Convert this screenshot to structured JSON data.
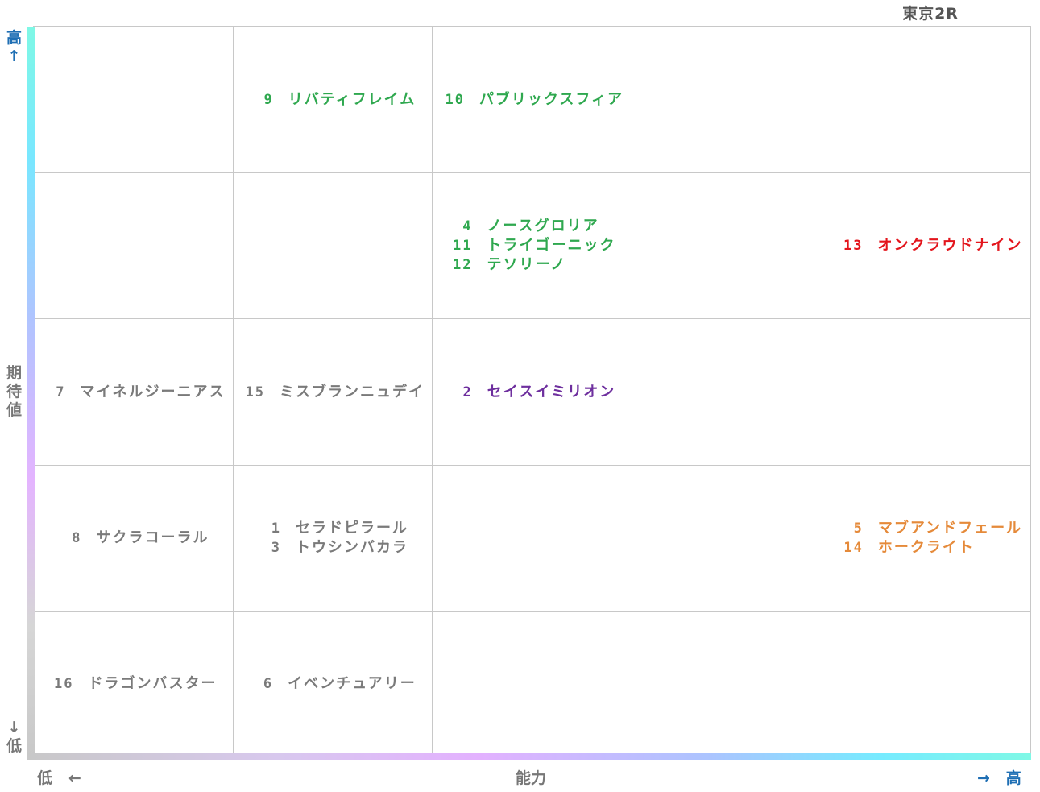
{
  "title": "東京2R",
  "axes": {
    "y_high": "高",
    "y_high_arrow": "↑",
    "y_label": [
      "期",
      "待",
      "値"
    ],
    "y_low_arrow": "↓",
    "y_low": "低",
    "x_low": "低",
    "x_low_arrow": "←",
    "x_label": "能力",
    "x_high_arrow": "→",
    "x_high": "高"
  },
  "colors": {
    "green": "#2fa84f",
    "red": "#e3151c",
    "purple": "#6e2f9e",
    "gray": "#7a7a7a",
    "orange": "#e58a3a",
    "axis_text": "#777777",
    "axis_accent": "#1f6fb4",
    "grid": "#c8c8c8"
  },
  "chart_data": {
    "type": "table",
    "title": "東京2R",
    "xlabel": "能力",
    "ylabel": "期待値",
    "columns": 5,
    "rows": 5,
    "cells": [
      {
        "row": 0,
        "col": 1,
        "color": "green",
        "entries": [
          {
            "num": "9",
            "name": "リバティフレイム"
          }
        ]
      },
      {
        "row": 0,
        "col": 2,
        "color": "green",
        "entries": [
          {
            "num": "10",
            "name": "パブリックスフィア"
          }
        ]
      },
      {
        "row": 1,
        "col": 2,
        "color": "green",
        "entries": [
          {
            "num": "4",
            "name": "ノースグロリア"
          },
          {
            "num": "11",
            "name": "トライゴーニック"
          },
          {
            "num": "12",
            "name": "テソリーノ"
          }
        ]
      },
      {
        "row": 1,
        "col": 4,
        "color": "red",
        "entries": [
          {
            "num": "13",
            "name": "オンクラウドナイン"
          }
        ]
      },
      {
        "row": 2,
        "col": 0,
        "color": "gray",
        "entries": [
          {
            "num": "7",
            "name": "マイネルジーニアス"
          }
        ]
      },
      {
        "row": 2,
        "col": 1,
        "color": "gray",
        "entries": [
          {
            "num": "15",
            "name": "ミスブランニュデイ"
          }
        ]
      },
      {
        "row": 2,
        "col": 2,
        "color": "purple",
        "entries": [
          {
            "num": "2",
            "name": "セイスイミリオン"
          }
        ]
      },
      {
        "row": 3,
        "col": 0,
        "color": "gray",
        "entries": [
          {
            "num": "8",
            "name": "サクラコーラル"
          }
        ]
      },
      {
        "row": 3,
        "col": 1,
        "color": "gray",
        "entries": [
          {
            "num": "1",
            "name": "セラドピラール"
          },
          {
            "num": "3",
            "name": "トウシンバカラ"
          }
        ]
      },
      {
        "row": 3,
        "col": 4,
        "color": "orange",
        "entries": [
          {
            "num": "5",
            "name": "マブアンドフェール"
          },
          {
            "num": "14",
            "name": "ホークライト"
          }
        ]
      },
      {
        "row": 4,
        "col": 0,
        "color": "gray",
        "entries": [
          {
            "num": "16",
            "name": "ドラゴンバスター"
          }
        ]
      },
      {
        "row": 4,
        "col": 1,
        "color": "gray",
        "entries": [
          {
            "num": "6",
            "name": "イベンチュアリー"
          }
        ]
      }
    ]
  }
}
